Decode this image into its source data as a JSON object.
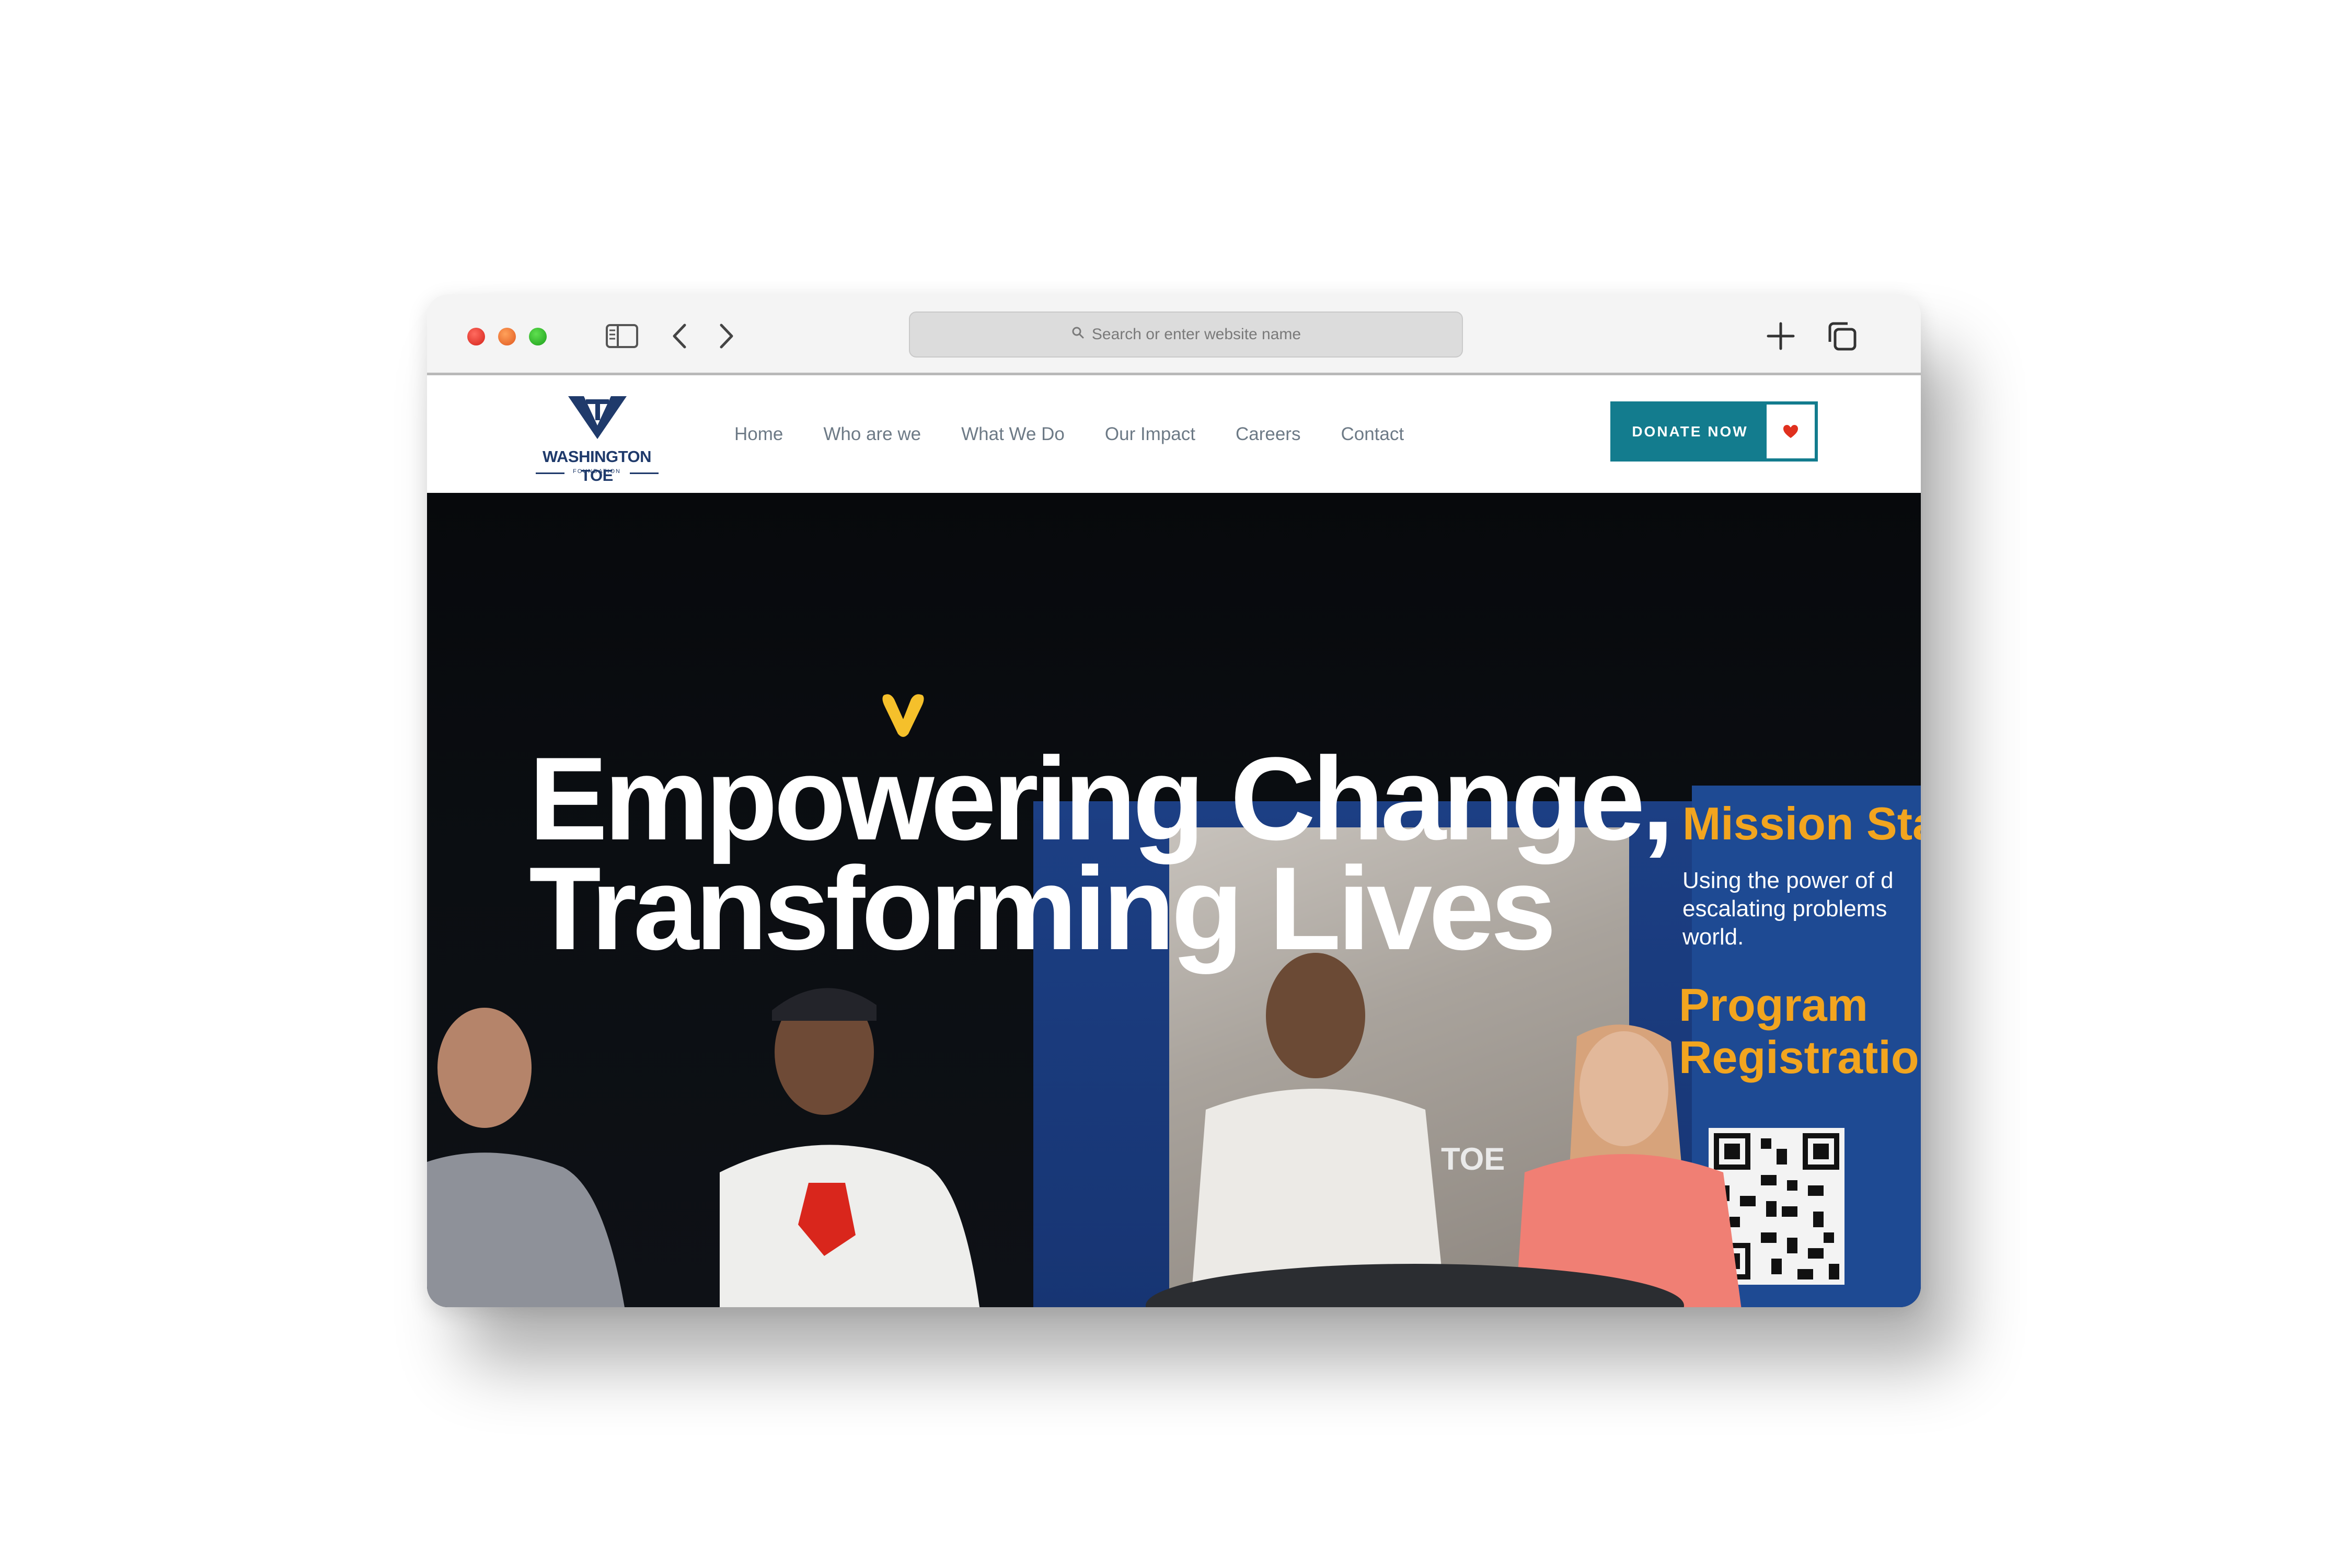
{
  "browser": {
    "address_placeholder": "Search or enter website name"
  },
  "site": {
    "logo_text": "WASHINGTON TOE",
    "logo_subtext": "FOUNDATION",
    "nav": [
      "Home",
      "Who are we",
      "What We Do",
      "Our Impact",
      "Careers",
      "Contact"
    ],
    "donate_label": "DONATE NOW"
  },
  "hero": {
    "title_line1": "Empowering Change,",
    "title_line2": "Transforming Lives",
    "banner": {
      "mission_title": "Mission Sta",
      "mission_text_1": "Using the power of d",
      "mission_text_2": "escalating  problems",
      "mission_text_3": "world.",
      "program_title_1": "Program",
      "program_title_2": "Registratio",
      "toe_label": "TOE"
    }
  },
  "colors": {
    "accent_teal": "#137c8e",
    "brand_navy": "#1f3a6b",
    "heart_red": "#e0301e",
    "hero_yellow": "#f5c02b",
    "banner_orange": "#f2a51f"
  },
  "icons": [
    "sidebar-icon",
    "back-icon",
    "forward-icon",
    "search-icon",
    "new-tab-icon",
    "tabs-overview-icon",
    "heart-icon"
  ]
}
